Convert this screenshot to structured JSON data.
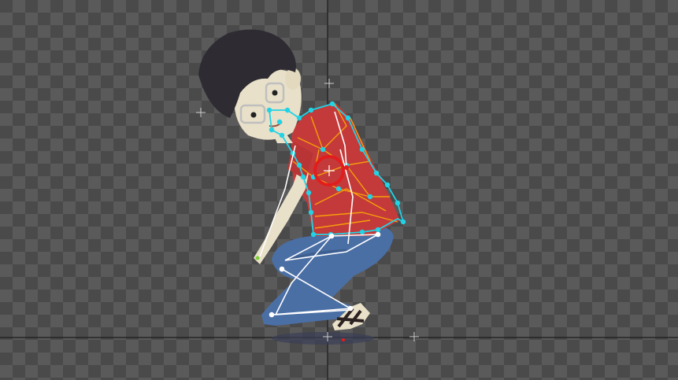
{
  "app": {
    "view": "mesh-deform-viewport"
  },
  "canvas": {
    "background": "transparency-checkerboard",
    "checker_colors": [
      "#4a4a4a",
      "#5a5a5a"
    ]
  },
  "guides": {
    "color": "#1c1c1c"
  },
  "mesh": {
    "outline_color": "#22d3e6",
    "wire_color": "#f59e0b"
  },
  "bones": {
    "color": "#ffffff"
  },
  "selection": {
    "color": "#e11d1d"
  },
  "character": {
    "hair_color": "#2e2b33",
    "skin_color": "#e8e0c8",
    "shirt_color": "#c43a3a",
    "jeans_color": "#4a6fa5",
    "sandal_color": "#2b2221"
  }
}
